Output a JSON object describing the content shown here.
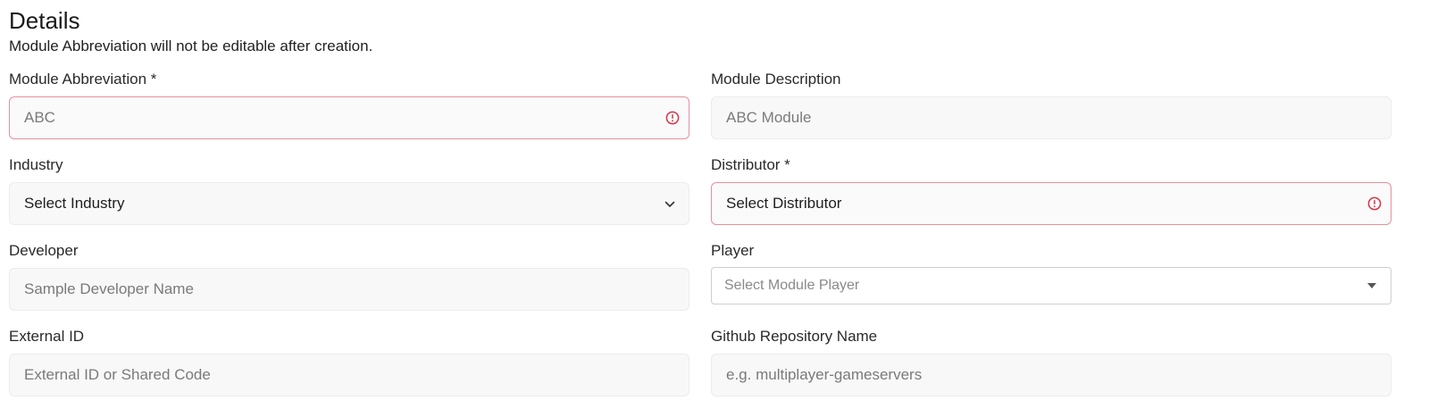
{
  "section": {
    "title": "Details",
    "subtitle": "Module Abbreviation will not be editable after creation."
  },
  "fields": {
    "module_abbreviation": {
      "label": "Module Abbreviation *",
      "placeholder": "ABC",
      "value": ""
    },
    "module_description": {
      "label": "Module Description",
      "placeholder": "ABC Module",
      "value": ""
    },
    "industry": {
      "label": "Industry",
      "selected": "Select Industry"
    },
    "distributor": {
      "label": "Distributor *",
      "selected": "Select Distributor"
    },
    "developer": {
      "label": "Developer",
      "placeholder": "Sample Developer Name",
      "value": ""
    },
    "player": {
      "label": "Player",
      "selected": "Select Module Player"
    },
    "external_id": {
      "label": "External ID",
      "placeholder": "External ID or Shared Code",
      "value": ""
    },
    "github_repo": {
      "label": "Github Repository Name",
      "placeholder": "e.g. multiplayer-gameservers",
      "value": ""
    }
  },
  "icons": {
    "error": "exclamation-circle-icon",
    "chevron": "chevron-down-icon",
    "caret": "caret-down-icon"
  },
  "colors": {
    "error_border": "#e8909c",
    "error_icon": "#d6334a",
    "input_bg": "#f8f8f8"
  }
}
